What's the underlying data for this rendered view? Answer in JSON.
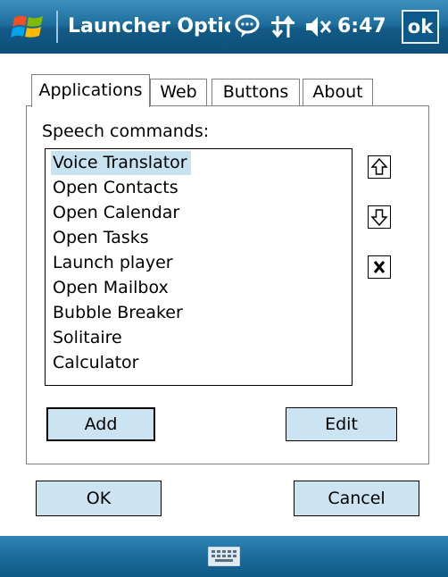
{
  "titlebar": {
    "title": "Launcher Options",
    "time": "6:47",
    "ok_label": "ok"
  },
  "tabs": [
    {
      "label": "Applications",
      "active": true
    },
    {
      "label": "Web",
      "active": false
    },
    {
      "label": "Buttons",
      "active": false
    },
    {
      "label": "About",
      "active": false
    }
  ],
  "applications": {
    "section_label": "Speech commands:",
    "commands": [
      "Voice Translator",
      "Open Contacts",
      "Open Calendar",
      "Open Tasks",
      "Launch player",
      "Open Mailbox",
      "Bubble Breaker",
      "Solitaire",
      "Calculator"
    ],
    "selected_index": 0,
    "add_label": "Add",
    "edit_label": "Edit"
  },
  "dialog": {
    "ok_label": "OK",
    "cancel_label": "Cancel"
  },
  "icons": {
    "start": "windows-flag-icon",
    "speech": "speech-bubble-icon",
    "connectivity": "connectivity-arrows-icon",
    "volume": "speaker-muted-icon",
    "move_up": "arrow-up-icon",
    "move_down": "arrow-down-icon",
    "delete": "x-icon",
    "keyboard": "keyboard-icon"
  },
  "colors": {
    "titlebar": "#1f6f9e",
    "button_fill": "#cce4f1",
    "selection": "#c7e2f0"
  }
}
